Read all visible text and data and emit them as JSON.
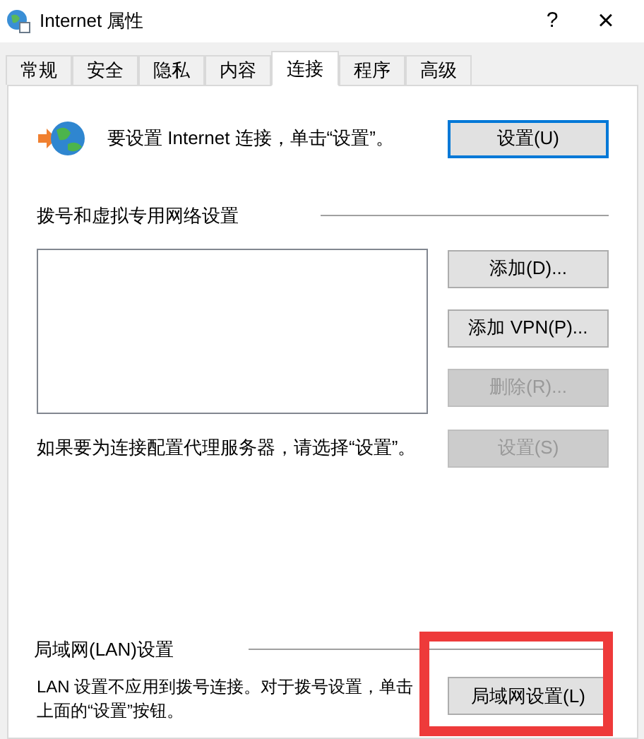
{
  "window": {
    "title": "Internet 属性",
    "help": "?",
    "close": "×"
  },
  "tabs": [
    {
      "label": "常规",
      "selected": false
    },
    {
      "label": "安全",
      "selected": false
    },
    {
      "label": "隐私",
      "selected": false
    },
    {
      "label": "内容",
      "selected": false
    },
    {
      "label": "连接",
      "selected": true
    },
    {
      "label": "程序",
      "selected": false
    },
    {
      "label": "高级",
      "selected": false
    }
  ],
  "setup": {
    "text": "要设置 Internet 连接，单击“设置”。",
    "button": {
      "label": "设置(U)",
      "focused": true
    }
  },
  "dialup": {
    "heading": "拨号和虚拟专用网络设置",
    "buttons": [
      {
        "label": "添加(D)...",
        "disabled": false
      },
      {
        "label": "添加 VPN(P)...",
        "disabled": false
      },
      {
        "label": "删除(R)...",
        "disabled": true
      }
    ],
    "proxy_text": "如果要为连接配置代理服务器，请选择“设置”。",
    "settings_button": {
      "label": "设置(S)",
      "disabled": true
    }
  },
  "lan": {
    "heading": "局域网(LAN)设置",
    "text": "LAN 设置不应用到拨号连接。对于拨号设置，单击上面的“设置”按钮。",
    "button": {
      "label": "局域网设置(L)",
      "highlighted": true
    }
  }
}
